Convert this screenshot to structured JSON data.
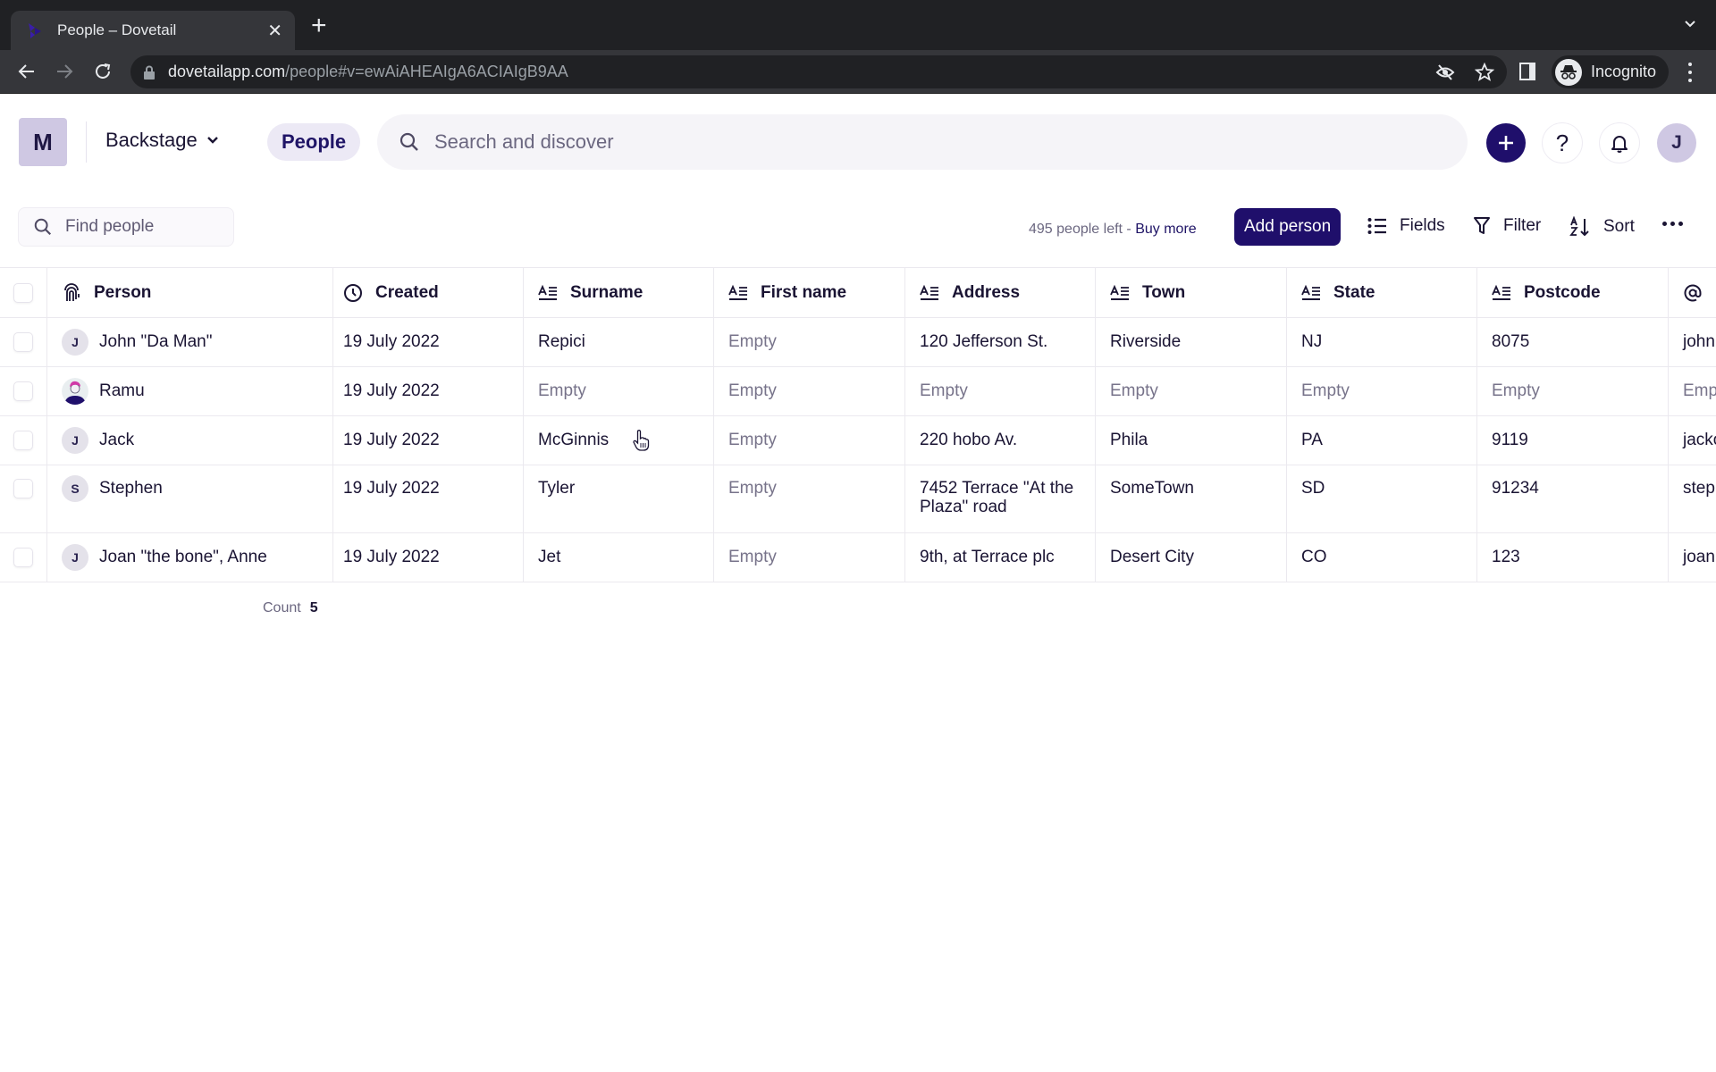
{
  "browser": {
    "tab_title": "People – Dovetail",
    "url_host": "dovetailapp.com",
    "url_path": "/people#v=ewAiAHEAIgA6ACIAIgB9AA",
    "incognito_label": "Incognito"
  },
  "header": {
    "workspace_initial": "M",
    "workspace_name": "Backstage",
    "nav_active": "People",
    "search_placeholder": "Search and discover",
    "help_label": "?",
    "user_initial": "J"
  },
  "toolbar": {
    "find_placeholder": "Find people",
    "quota_text": "495 people left - ",
    "buy_more": "Buy more",
    "add_person": "Add person",
    "fields": "Fields",
    "filter": "Filter",
    "sort": "Sort"
  },
  "table": {
    "columns": [
      "Person",
      "Created",
      "Surname",
      "First name",
      "Address",
      "Town",
      "State",
      "Postcode",
      ""
    ],
    "rows": [
      {
        "initial": "J",
        "person": "John \"Da Man\"",
        "created": "19 July 2022",
        "surname": "Repici",
        "first_name": "Empty",
        "address": "120 Jefferson St.",
        "town": "Riverside",
        "state": "NJ",
        "postcode": "8075",
        "email": "john"
      },
      {
        "initial": "",
        "person": "Ramu",
        "created": "19 July 2022",
        "surname": "Empty",
        "first_name": "Empty",
        "address": "Empty",
        "town": "Empty",
        "state": "Empty",
        "postcode": "Empty",
        "email": "Emp"
      },
      {
        "initial": "J",
        "person": "Jack",
        "created": "19 July 2022",
        "surname": "McGinnis",
        "first_name": "Empty",
        "address": "220 hobo Av.",
        "town": "Phila",
        "state": "PA",
        "postcode": "9119",
        "email": "jacko"
      },
      {
        "initial": "S",
        "person": "Stephen",
        "created": "19 July 2022",
        "surname": "Tyler",
        "first_name": "Empty",
        "address": "7452 Terrace \"At the Plaza\" road",
        "town": "SomeTown",
        "state": "SD",
        "postcode": "91234",
        "email": "step"
      },
      {
        "initial": "J",
        "person": "Joan \"the bone\", Anne",
        "created": "19 July 2022",
        "surname": "Jet",
        "first_name": "Empty",
        "address": "9th, at Terrace plc",
        "town": "Desert City",
        "state": "CO",
        "postcode": "123",
        "email": "joan"
      }
    ],
    "count_label": "Count",
    "count_value": "5"
  },
  "colors": {
    "brand": "#1f0f6b",
    "avatar_bg": "#cfc8e3",
    "empty_text": "#77738a"
  }
}
